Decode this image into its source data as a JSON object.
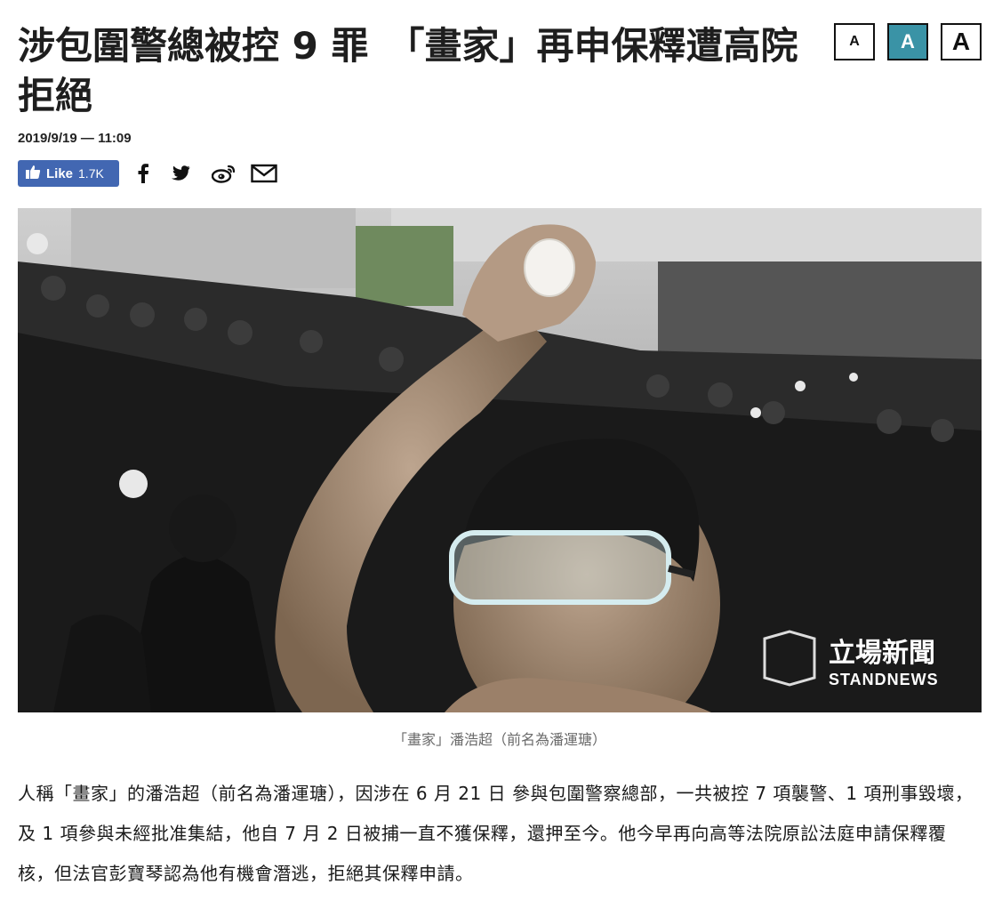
{
  "article": {
    "headline": "涉包圍警總被控 9 罪　「畫家」再申保釋遭高院拒絕",
    "dateline": "2019/9/19 — 11:09",
    "caption": "「畫家」潘浩超（前名為潘運瑭）",
    "body": "人稱「畫家」的潘浩超（前名為潘運瑭），因涉在 6 月 21 日 參與包圍警察總部，一共被控 7 項襲警、1 項刑事毀壞，及 1 項參與未經批准集結，他自 7 月 2 日被捕一直不獲保釋，還押至今。他今早再向高等法院原訟法庭申請保釋覆核，但法官彭寶琴認為他有機會潛逃，拒絕其保釋申請。"
  },
  "font_size_buttons": [
    {
      "label": "A",
      "size": "small"
    },
    {
      "label": "A",
      "size": "medium",
      "active": true
    },
    {
      "label": "A",
      "size": "large"
    }
  ],
  "share": {
    "like_label": "Like",
    "like_count": "1.7K",
    "icons": [
      "facebook-icon",
      "twitter-icon",
      "weibo-icon",
      "email-icon"
    ]
  },
  "photo": {
    "watermark_cn": "立場新聞",
    "watermark_en": "STANDNEWS"
  },
  "colors": {
    "accent": "#3a93a6",
    "facebook": "#4267b2",
    "text": "#1a1a1a",
    "caption": "#6a6a6a"
  }
}
